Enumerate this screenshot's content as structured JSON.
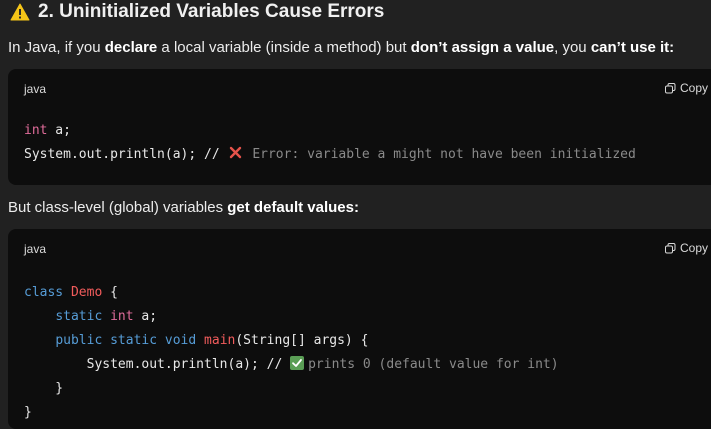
{
  "heading": {
    "text": "2. Uninitialized Variables Cause Errors"
  },
  "intro": {
    "t1": "In Java, if you ",
    "b1": "declare",
    "t2": " a local variable (inside a method) but ",
    "b2": "don’t assign a value",
    "t3": ", you ",
    "b3": "can’t use it:"
  },
  "code_block_1": {
    "language": "java",
    "copy_label": "Copy",
    "line1": {
      "type": "int",
      "rest": " a;"
    },
    "line2": {
      "code": "System.out.println(a); // ",
      "comment": "Error: variable a might not have been initialized"
    }
  },
  "middle": {
    "t1": "But class-level (global) variables ",
    "b1": "get default values:"
  },
  "code_block_2": {
    "language": "java",
    "copy_label": "Copy",
    "l1_kw": "class",
    "l1_name": "Demo",
    "l1_rest": " {",
    "l2_indent": "    ",
    "l2_kw": "static",
    "l2_type": "int",
    "l2_rest": " a;",
    "l3_indent": "    ",
    "l3_kw1": "public",
    "l3_kw2": "static",
    "l3_kw3": "void",
    "l3_fn": "main",
    "l3_rest": "(String[] args) {",
    "l4_code": "        System.out.println(a); // ",
    "l4_comment": "prints 0 (default value for int)",
    "l5": "    }",
    "l6": "}"
  },
  "colors": {
    "background": "#212121",
    "code_background": "#0d0d0d",
    "warning": "#f5c518",
    "error_x": "#e5534b",
    "check": "#5a9e55"
  }
}
